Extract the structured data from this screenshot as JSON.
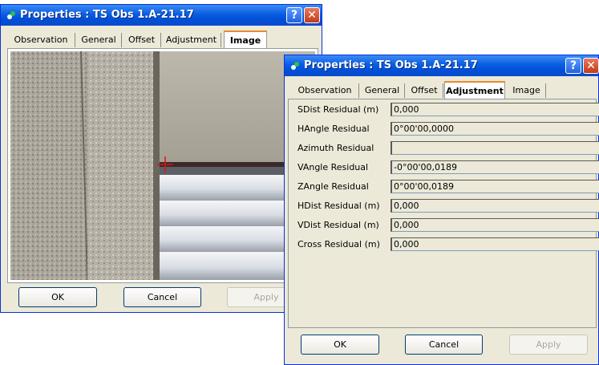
{
  "back_window": {
    "title": "Properties : TS Obs 1.A-21.17",
    "tabs": [
      "Observation",
      "General",
      "Offset",
      "Adjustment",
      "Image"
    ],
    "active_tab": "Image",
    "buttons": {
      "ok": "OK",
      "cancel": "Cancel",
      "apply": "Apply"
    }
  },
  "front_window": {
    "title": "Properties : TS Obs 1.A-21.17",
    "tabs": [
      "Observation",
      "General",
      "Offset",
      "Adjustment",
      "Image"
    ],
    "active_tab": "Adjustment",
    "fields": [
      {
        "label": "SDist Residual (m)",
        "value": "0,000"
      },
      {
        "label": "HAngle Residual",
        "value": "0°00'00,0000"
      },
      {
        "label": "Azimuth Residual",
        "value": ""
      },
      {
        "label": "VAngle Residual",
        "value": "-0°00'00,0189"
      },
      {
        "label": "ZAngle Residual",
        "value": "0°00'00,0189"
      },
      {
        "label": "HDist Residual (m)",
        "value": "0,000"
      },
      {
        "label": "VDist Residual (m)",
        "value": "0,000"
      },
      {
        "label": "Cross Residual (m)",
        "value": "0,000"
      }
    ],
    "buttons": {
      "ok": "OK",
      "cancel": "Cancel",
      "apply": "Apply"
    }
  },
  "icons": {
    "title_icon": "survey-icon",
    "help": "help-icon",
    "close": "close-icon"
  },
  "colors": {
    "title_bar": "#0a5de0",
    "active_tab_accent": "#e68b2c",
    "window_bg": "#ece9d8"
  }
}
